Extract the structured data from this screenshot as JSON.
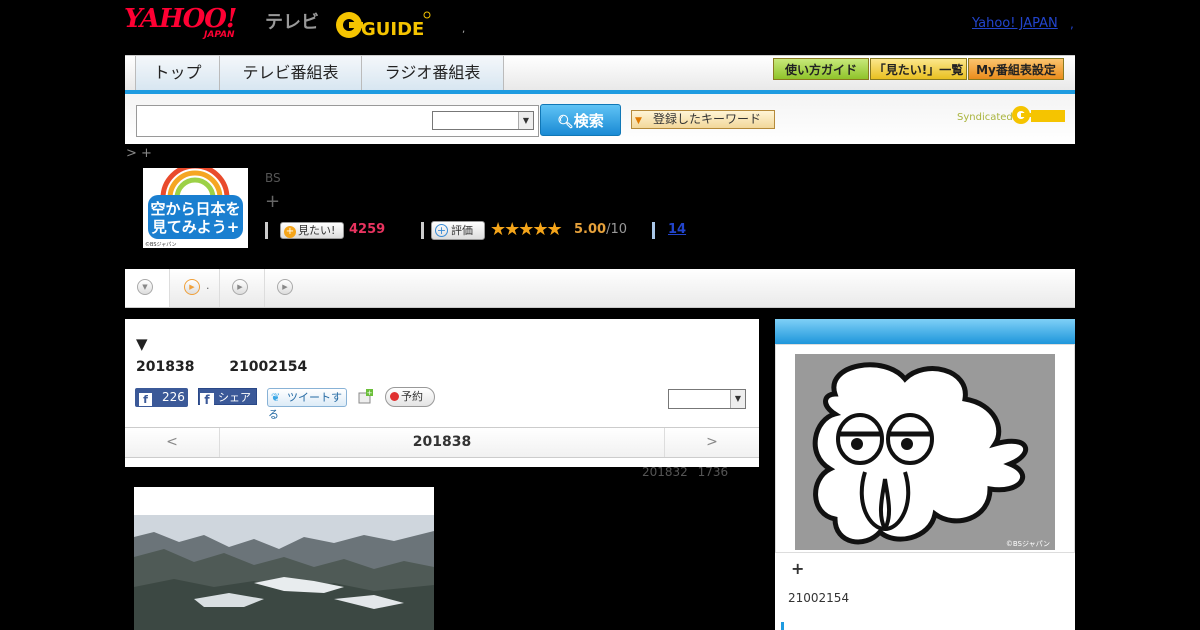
{
  "header": {
    "yahoo_logo_main": "YAHOO!",
    "yahoo_logo_sub": "JAPAN",
    "tv_word": "テレビ",
    "gguide_logo_text": "GUIDE",
    "separator_dot": ",",
    "yahoo_japan_link": "Yahoo! JAPAN",
    "trailing_dot": ","
  },
  "nav": {
    "tabs": [
      {
        "label": "トップ"
      },
      {
        "label": "テレビ番組表"
      },
      {
        "label": "ラジオ番組表"
      }
    ],
    "utility": [
      {
        "label": "使い方ガイド",
        "color": "#a7d63c"
      },
      {
        "label": "「見たい!」一覧",
        "color": "#f6d34a"
      },
      {
        "label": "My番組表設定",
        "color": "#f4a53b"
      }
    ]
  },
  "search": {
    "button_label": "検索",
    "keyword_button_label": "登録したキーワード",
    "syndicated_label": "Syndicated"
  },
  "breadcrumb": "> +",
  "program": {
    "image_text": "空から日本を見てみよう+",
    "image_credit": "©BSジャパン",
    "channel": "BS",
    "title": "+",
    "want_label": "見たい!",
    "want_count": "4259",
    "eval_label": "評価",
    "stars": "★★★★★",
    "rating": "5.00",
    "rating_max": "/10",
    "review_count": "14"
  },
  "subtabs": {
    "second_label": "."
  },
  "detail": {
    "triangle": "▼",
    "date": "201838",
    "program_id": "21002154",
    "fb_like_count": "226",
    "fb_share_label": "シェア",
    "tweet_label": "ツイートする",
    "reserve_label": "予約",
    "pager": {
      "prev": "<",
      "current": "201838",
      "next": ">"
    },
    "updated_date": "201832",
    "updated_time": "1736"
  },
  "sidebar": {
    "mascot_credit": "©BSジャパン",
    "plus": "+",
    "program_id": "21002154"
  }
}
